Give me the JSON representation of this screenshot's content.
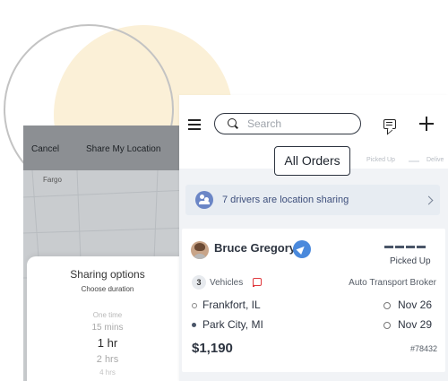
{
  "share_screen": {
    "cancel_label": "Cancel",
    "title": "Share My Location",
    "map_city": "Fargo",
    "sheet_title": "Sharing options",
    "sheet_subtitle": "Choose duration",
    "duration_options": [
      "One time",
      "15 mins",
      "1 hr",
      "2 hrs",
      "4 hrs"
    ],
    "selected_option": "1 hr"
  },
  "app": {
    "search": {
      "placeholder": "Search"
    },
    "tooltip": "All Orders",
    "tabs": [
      "Picked Up",
      "Delive"
    ],
    "banner": {
      "text": "7 drivers are location sharing"
    },
    "order": {
      "driver_name": "Bruce Gregory",
      "status": "Picked Up",
      "vehicle_count": "3",
      "vehicles_label": "Vehicles",
      "broker": "Auto Transport Broker",
      "origin": "Frankfort, IL",
      "destination": "Park City, MI",
      "pickup_date": "Nov 26",
      "delivery_date": "Nov 29",
      "price": "$1,190",
      "order_number": "#78432"
    }
  },
  "colors": {
    "accent_blue": "#4a89dc",
    "banner_bg": "#e7ecf2",
    "banner_text": "#3e4f7c",
    "truck_red": "#e0393e",
    "blob_yellow": "#fbf0d7"
  },
  "icons": [
    "menu-icon",
    "search-icon",
    "chat-icon",
    "plus-icon",
    "drivers-icon",
    "chevron-right-icon",
    "location-arrow-icon",
    "truck-icon",
    "clock-icon",
    "check-circle-icon",
    "map-pin-icon"
  ]
}
